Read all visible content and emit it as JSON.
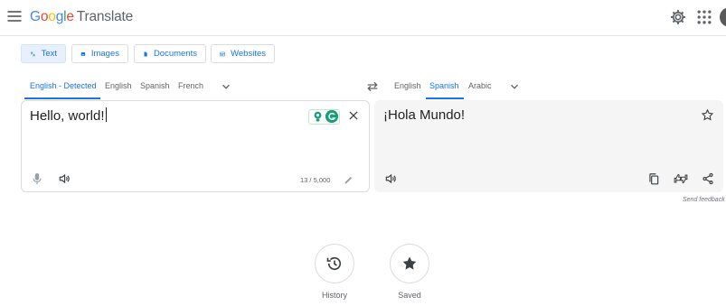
{
  "header": {
    "brand_letters": [
      "G",
      "o",
      "o",
      "g",
      "l",
      "e"
    ],
    "brand_colors": [
      "#4285F4",
      "#EA4335",
      "#FBBC05",
      "#4285F4",
      "#34A853",
      "#EA4335"
    ],
    "product": "Translate"
  },
  "modes": [
    {
      "label": "Text",
      "icon": "translate-icon",
      "active": true
    },
    {
      "label": "Images",
      "icon": "image-icon",
      "active": false
    },
    {
      "label": "Documents",
      "icon": "document-icon",
      "active": false
    },
    {
      "label": "Websites",
      "icon": "website-icon",
      "active": false
    }
  ],
  "source_langs": [
    "English - Detected",
    "English",
    "Spanish",
    "French"
  ],
  "target_langs": [
    "English",
    "Spanish",
    "Arabic"
  ],
  "source": {
    "text": "Hello, world!",
    "char_count": "13 / 5,000"
  },
  "target": {
    "text": "¡Hola Mundo!"
  },
  "feedback": "Send feedback",
  "bottom": {
    "history": "History",
    "saved": "Saved"
  },
  "colors": {
    "accent": "#1a73e8",
    "target_panel_bg": "#f5f5f5",
    "extension_green": "#15a07a"
  }
}
